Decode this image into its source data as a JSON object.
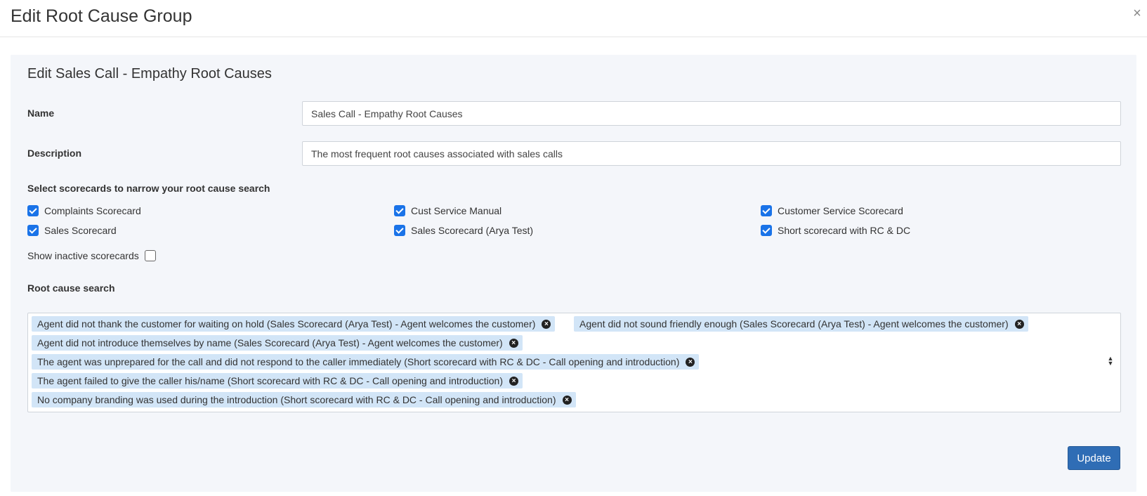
{
  "modal": {
    "title": "Edit Root Cause Group",
    "close_label": "×"
  },
  "panel": {
    "title": "Edit Sales Call - Empathy Root Causes"
  },
  "form": {
    "name_label": "Name",
    "name_value": "Sales Call - Empathy Root Causes",
    "description_label": "Description",
    "description_value": "The most frequent root causes associated with sales calls",
    "scorecards_label": "Select scorecards to narrow your root cause search",
    "scorecards": [
      {
        "label": "Complaints Scorecard",
        "checked": true
      },
      {
        "label": "Cust Service Manual",
        "checked": true
      },
      {
        "label": "Customer Service Scorecard",
        "checked": true
      },
      {
        "label": "Sales Scorecard",
        "checked": true
      },
      {
        "label": "Sales Scorecard (Arya Test)",
        "checked": true
      },
      {
        "label": "Short scorecard with RC & DC",
        "checked": true
      }
    ],
    "show_inactive_label": "Show inactive scorecards",
    "show_inactive_checked": false,
    "root_cause_label": "Root cause search",
    "root_causes": [
      "Agent did not thank the customer for waiting on hold (Sales Scorecard (Arya Test) - Agent welcomes the customer)",
      "Agent did not sound friendly enough (Sales Scorecard (Arya Test) - Agent welcomes the customer)",
      "Agent did not introduce themselves by name (Sales Scorecard (Arya Test) - Agent welcomes the customer)",
      "The agent was unprepared for the call and did not respond to the caller immediately (Short scorecard with RC & DC - Call opening and introduction)",
      "The agent failed to give the caller his/name (Short scorecard with RC & DC - Call opening and introduction)",
      "No company branding was used during the introduction (Short scorecard with RC & DC - Call opening and introduction)"
    ],
    "tag_remove_icon": "×"
  },
  "actions": {
    "update_label": "Update"
  },
  "colors": {
    "accent": "#1a73e8",
    "button": "#2f6db5",
    "tag_bg": "#d2e5f7",
    "panel_bg": "#f4f6fa"
  }
}
